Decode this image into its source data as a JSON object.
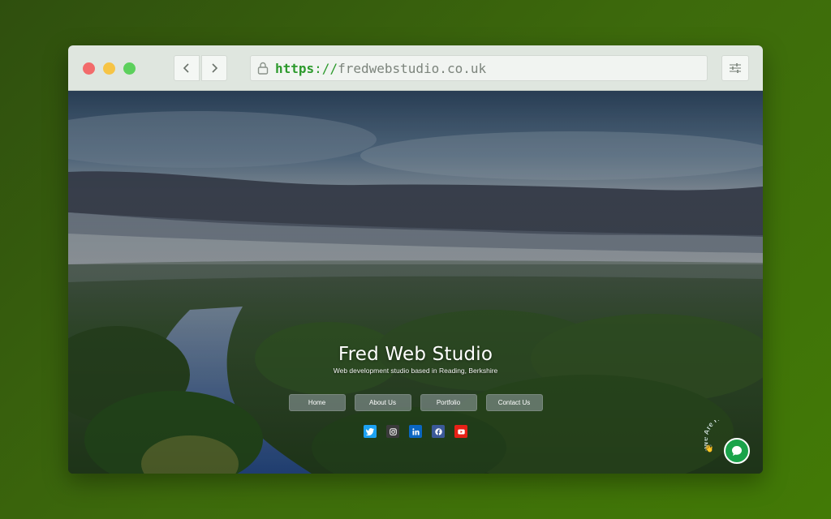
{
  "browser": {
    "url_scheme": "https",
    "url_separator": "://",
    "url_host": "fredwebstudio.co.uk",
    "back_icon": "chevron-left-icon",
    "forward_icon": "chevron-right-icon",
    "lock_icon": "lock-icon",
    "settings_icon": "sliders-icon"
  },
  "hero": {
    "title": "Fred Web Studio",
    "subtitle": "Web development studio based in Reading, Berkshire"
  },
  "nav": {
    "items": [
      {
        "label": "Home"
      },
      {
        "label": "About Us"
      },
      {
        "label": "Portfolio"
      },
      {
        "label": "Contact Us"
      }
    ]
  },
  "social": [
    {
      "name": "twitter-icon",
      "color": "#1da1f2"
    },
    {
      "name": "instagram-icon",
      "color": "#3a3a3a"
    },
    {
      "name": "linkedin-icon",
      "color": "#0a66c2"
    },
    {
      "name": "facebook-icon",
      "color": "#3b5998"
    },
    {
      "name": "youtube-icon",
      "color": "#e62117"
    }
  ],
  "chat": {
    "label": "We Are Here!",
    "color": "#1aa34a"
  },
  "colors": {
    "accent_green": "#2d9a2d",
    "background": "#3d6a0c"
  }
}
